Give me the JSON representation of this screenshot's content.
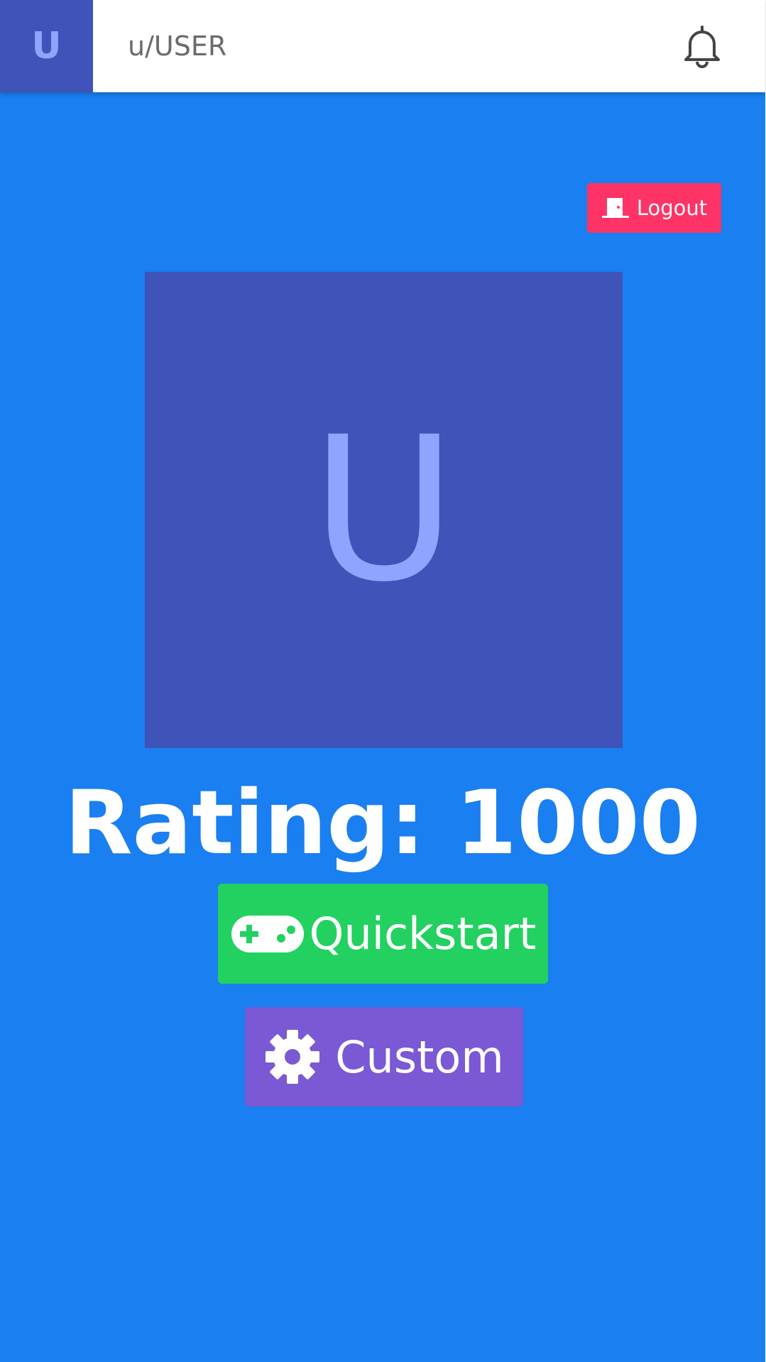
{
  "header": {
    "avatar_initial": "U",
    "username": "u/USER",
    "notifications_icon": "bell-icon"
  },
  "logout": {
    "label": "Logout",
    "icon": "door-icon"
  },
  "profile": {
    "avatar_initial": "U",
    "rating_text": "Rating: 1000"
  },
  "actions": {
    "quickstart_label": "Quickstart",
    "quickstart_icon": "gamepad-icon",
    "custom_label": "Custom",
    "custom_icon": "gear-icon"
  },
  "colors": {
    "background": "#1a7ff0",
    "avatar_bg": "#4053b8",
    "avatar_text": "#8ea4ff",
    "logout": "#ff3366",
    "quickstart": "#22d15f",
    "custom": "#7b58d4"
  }
}
